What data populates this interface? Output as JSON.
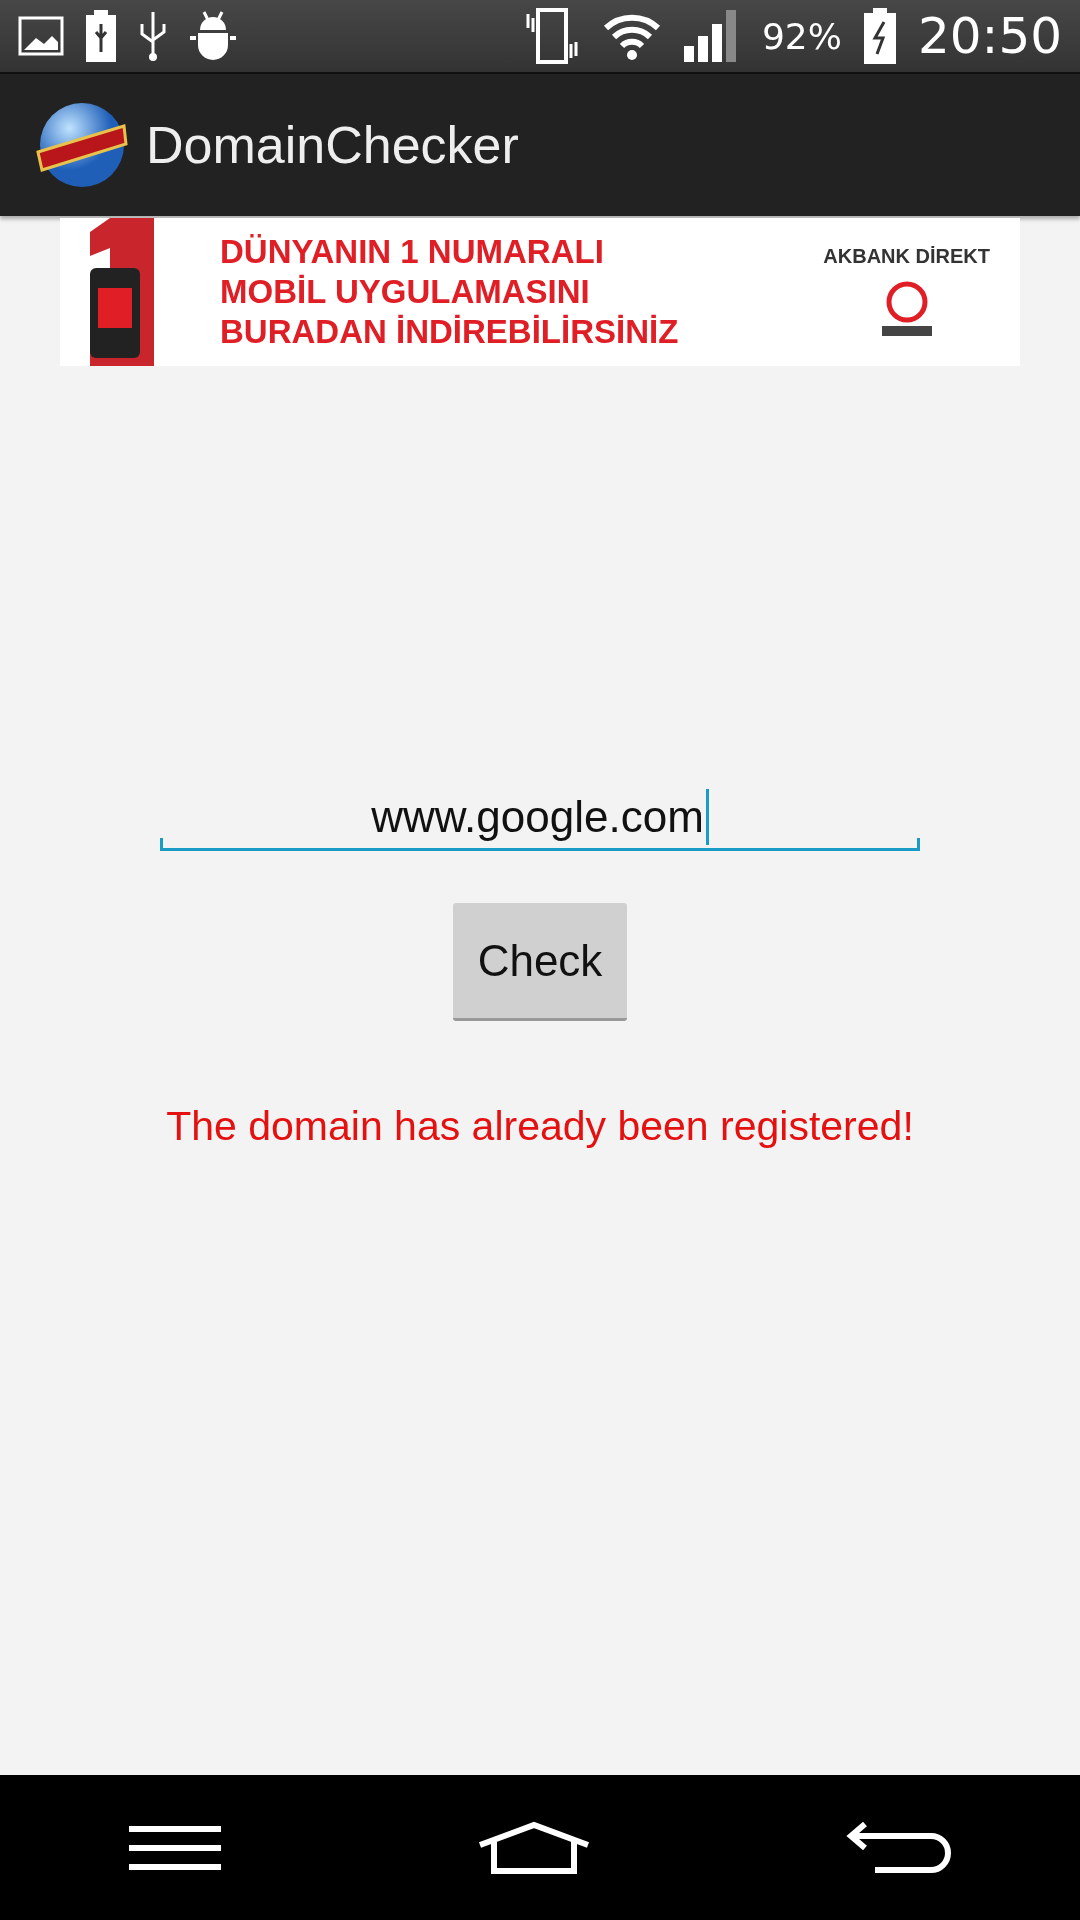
{
  "status_bar": {
    "battery": "92%",
    "time": "20:50"
  },
  "app_bar": {
    "title": "DomainChecker"
  },
  "ad_banner": {
    "headline": [
      "DÜNYANIN 1 NUMARALI",
      "MOBİL UYGULAMASINI",
      "BURADAN İNDİREBİLİRSİNİZ"
    ],
    "brand": "AKBANK DİREKT"
  },
  "domain_field": {
    "value": "www.google.com",
    "focused": true
  },
  "check_button": {
    "label": "Check"
  },
  "result": {
    "text": "The domain has already been registered!",
    "kind": "error"
  }
}
